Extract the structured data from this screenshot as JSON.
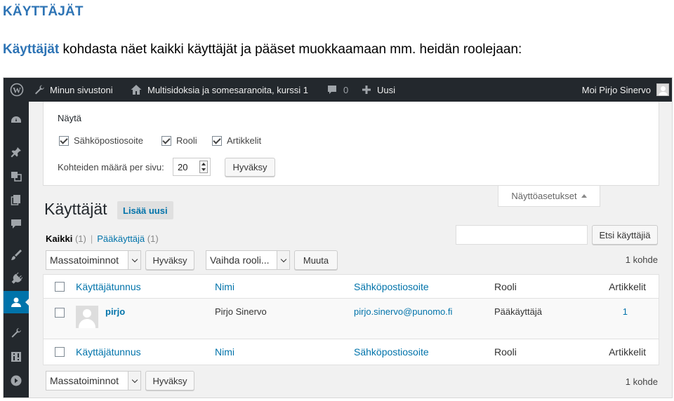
{
  "doc": {
    "heading": "KÄYTTÄJÄT",
    "intro_lead": "Käyttäjät",
    "intro_rest": " kohdasta näet kaikki käyttäjät ja pääset muokkaamaan mm. heidän roolejaan:"
  },
  "adminbar": {
    "site_label": "Minun sivustoni",
    "home_label": "Multisidoksia ja somesaranoita, kurssi 1",
    "comments_count": "0",
    "new_label": "Uusi",
    "greeting": "Moi Pirjo Sinervo"
  },
  "screen_options": {
    "title": "Näytä",
    "checkboxes": [
      {
        "label": "Sähköpostiosoite",
        "checked": true
      },
      {
        "label": "Rooli",
        "checked": true
      },
      {
        "label": "Artikkelit",
        "checked": true
      }
    ],
    "per_page_label": "Kohteiden määrä per sivu:",
    "per_page_value": "20",
    "apply_label": "Hyväksy",
    "tab_label": "Näyttöasetukset"
  },
  "page": {
    "title": "Käyttäjät",
    "add_new": "Lisää uusi"
  },
  "filters": {
    "all_label": "Kaikki",
    "all_count": "(1)",
    "separator": "|",
    "admin_label": "Pääkäyttäjä",
    "admin_count": "(1)"
  },
  "search": {
    "button_label": "Etsi käyttäjiä",
    "value": ""
  },
  "bulk": {
    "actions_label": "Massatoiminnot",
    "apply_label": "Hyväksy",
    "role_label": "Vaihda rooli...",
    "change_label": "Muuta",
    "count": "1 kohde"
  },
  "table": {
    "columns": [
      "Käyttäjätunnus",
      "Nimi",
      "Sähköpostiosoite",
      "Rooli",
      "Artikkelit"
    ],
    "rows": [
      {
        "username": "pirjo",
        "name": "Pirjo Sinervo",
        "email": "pirjo.sinervo@punomo.fi",
        "role": "Pääkäyttäjä",
        "posts": "1"
      }
    ]
  },
  "colors": {
    "admin_bar": "#23282d",
    "accent": "#0073aa",
    "doc_heading": "#2e74b5"
  },
  "icons": [
    "wordpress-icon",
    "wrench-icon",
    "home-icon",
    "comment-icon",
    "plus-icon",
    "dashboard-icon",
    "pin-icon",
    "media-icon",
    "pages-icon",
    "comments-menu-icon",
    "appearance-icon",
    "plugins-icon",
    "users-icon",
    "tools-icon",
    "settings-icon",
    "collapse-icon"
  ]
}
